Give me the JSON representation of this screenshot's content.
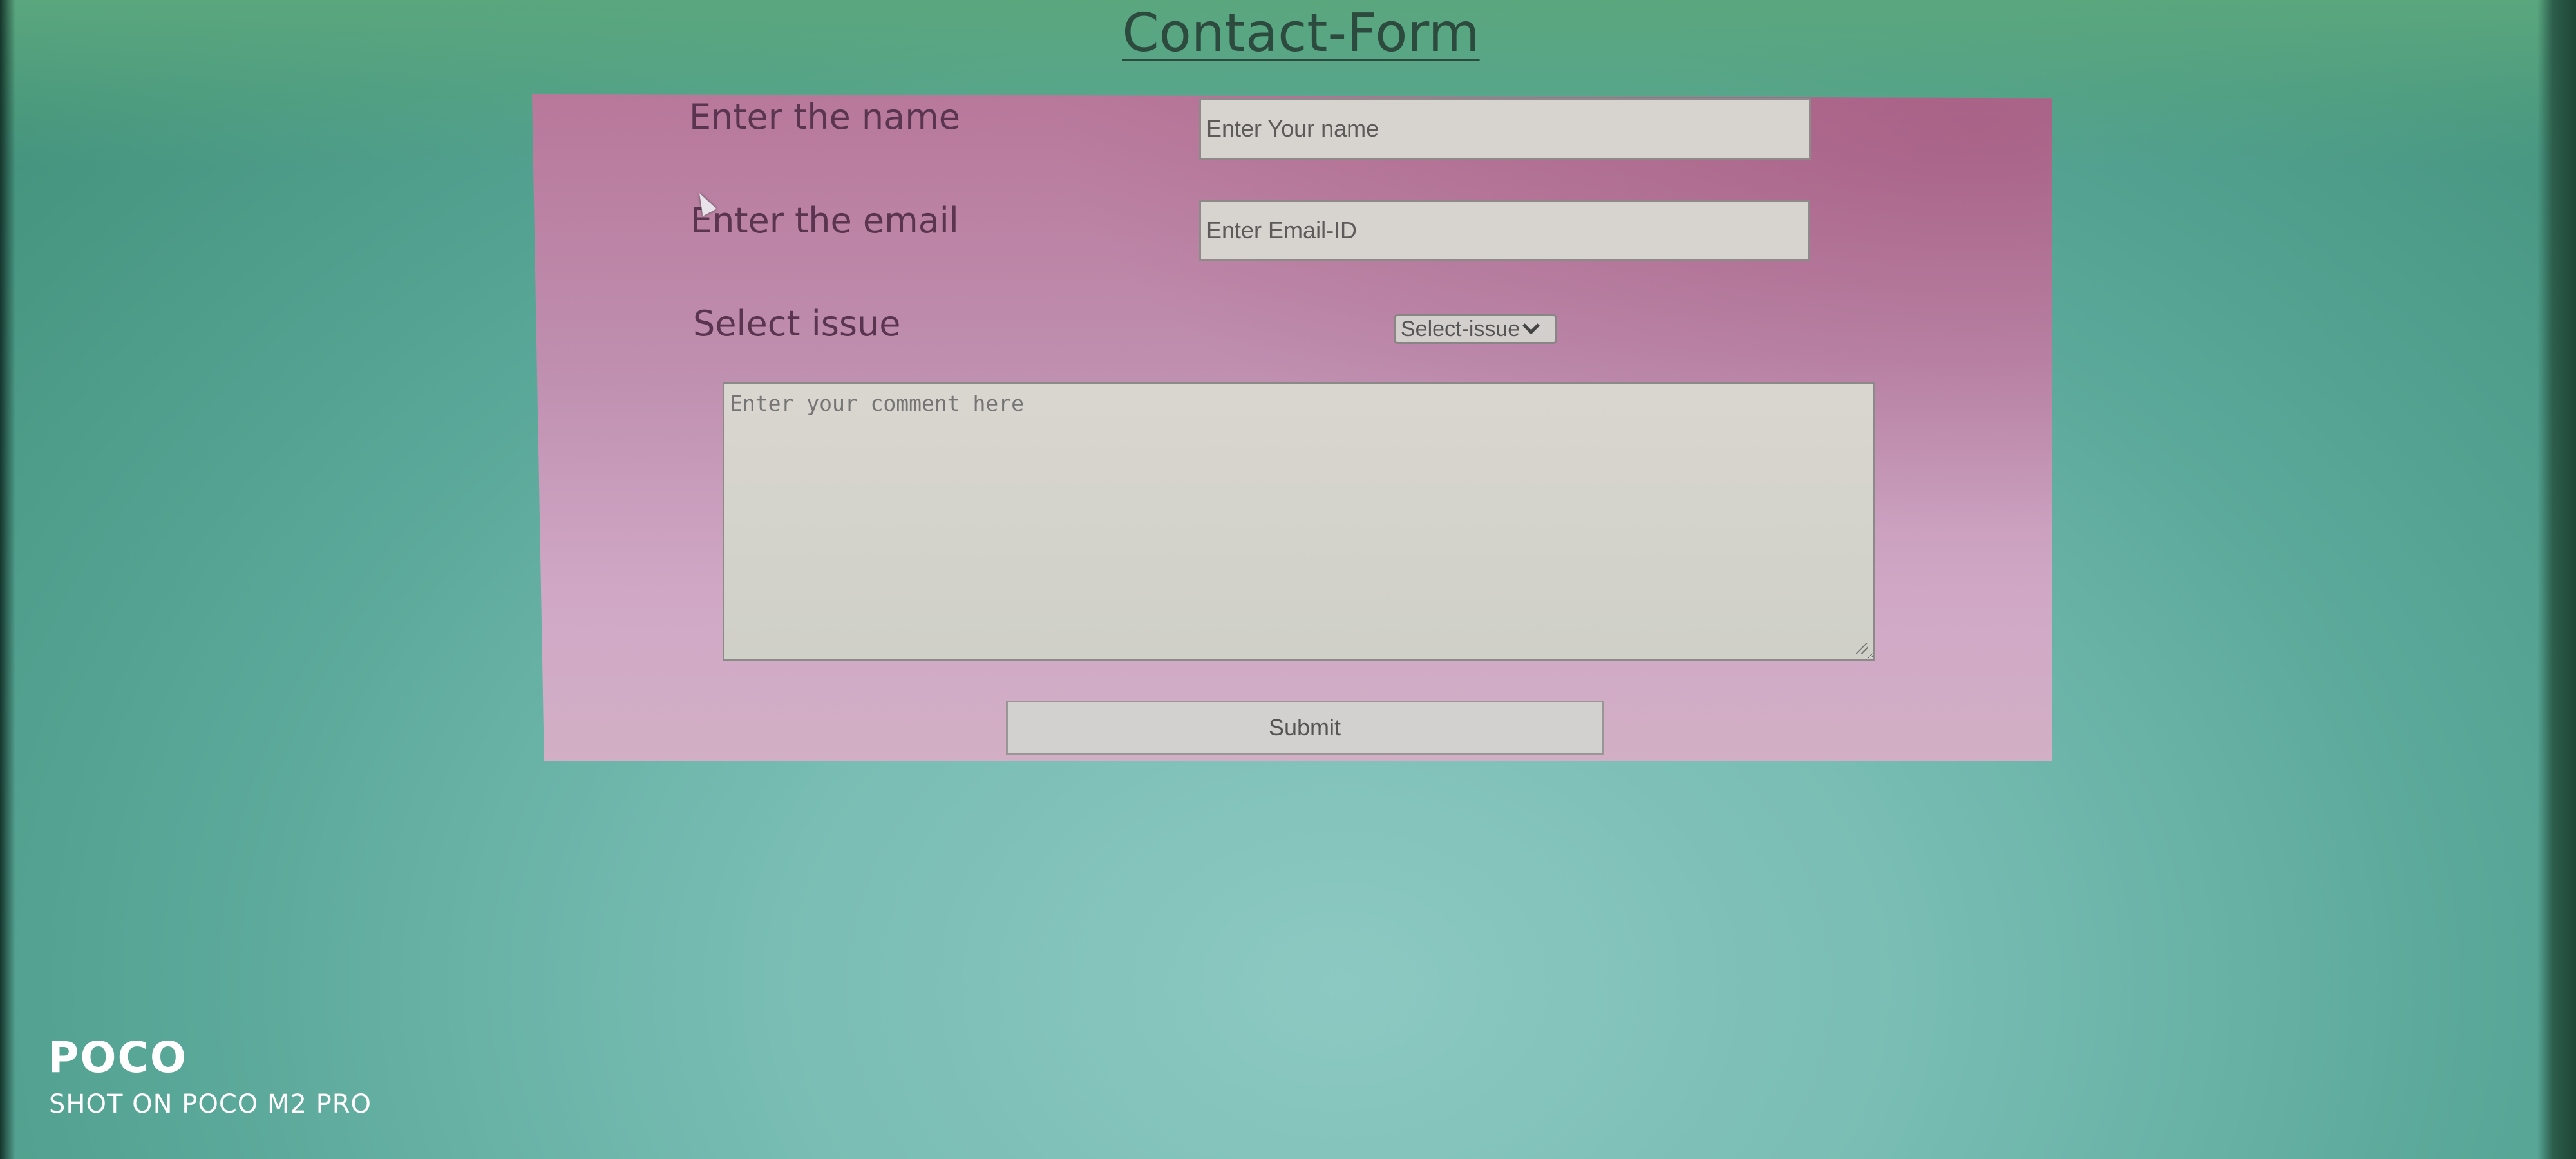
{
  "page": {
    "title": "Contact-Form"
  },
  "form": {
    "name_label": "Enter the name",
    "name_placeholder": "Enter Your name",
    "email_label": "Enter the email",
    "email_placeholder": "Enter Email-ID",
    "issue_label": "Select issue",
    "issue_selected": "Select-issue",
    "comment_placeholder": "Enter your comment here",
    "submit_label": "Submit"
  },
  "watermark": {
    "brand": "POCO",
    "caption": "SHOT ON POCO M2 PRO"
  },
  "colors": {
    "background": "#7cc0b6",
    "panel": "#c594b4",
    "title": "#2c4a3e",
    "label": "#5a3550",
    "input": "#d7d3cf"
  },
  "icons": {
    "select_arrow": "chevron-down-icon",
    "cursor": "mouse-pointer-icon",
    "textarea_grip": "resize-grip-icon"
  }
}
